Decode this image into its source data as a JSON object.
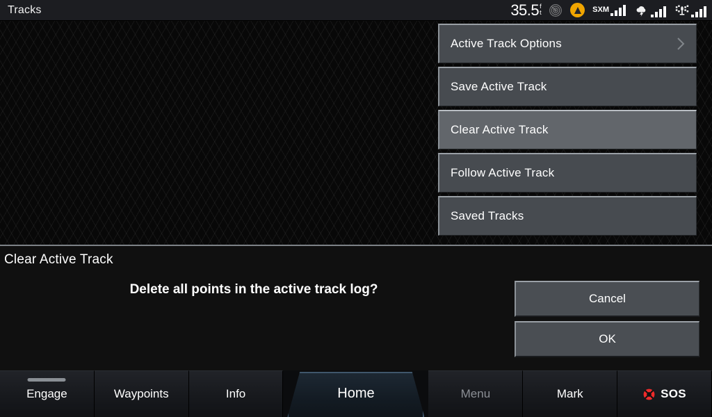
{
  "status": {
    "title": "Tracks",
    "depth_value": "35.5",
    "depth_unit_line1": "f",
    "depth_unit_line2": "t",
    "radar_icon": "radar-icon",
    "compass_icon": "compass-heading-icon",
    "sxm_label": "SXM",
    "sxm_icon": "sxm-signal-icon",
    "weather_icon": "weather-storm-icon",
    "satellite_icon": "satellite-signal-icon"
  },
  "menu": {
    "items": [
      {
        "label": "Active Track Options",
        "has_chevron": true,
        "highlighted": false
      },
      {
        "label": "Save Active Track",
        "has_chevron": false,
        "highlighted": false
      },
      {
        "label": "Clear Active Track",
        "has_chevron": false,
        "highlighted": true
      },
      {
        "label": "Follow Active Track",
        "has_chevron": false,
        "highlighted": false
      },
      {
        "label": "Saved Tracks",
        "has_chevron": false,
        "highlighted": false
      }
    ]
  },
  "dialog": {
    "title": "Clear Active Track",
    "message": "Delete all points in the active track log?",
    "cancel_label": "Cancel",
    "ok_label": "OK"
  },
  "navbar": {
    "tabs": [
      {
        "label": "Engage",
        "state": "normal",
        "indicator": true
      },
      {
        "label": "Waypoints",
        "state": "normal",
        "indicator": false
      },
      {
        "label": "Info",
        "state": "normal",
        "indicator": false
      },
      {
        "label": "Home",
        "state": "selected",
        "indicator": false
      },
      {
        "label": "Menu",
        "state": "dim",
        "indicator": false
      },
      {
        "label": "Mark",
        "state": "normal",
        "indicator": false
      },
      {
        "label": "SOS",
        "state": "sos",
        "indicator": false
      }
    ]
  },
  "colors": {
    "accent_blue": "#3f566b",
    "sos_red": "#ef2b2b",
    "compass_amber": "#f0a500",
    "menu_gray": "#474b50",
    "menu_gray_highlight": "#62666b"
  }
}
